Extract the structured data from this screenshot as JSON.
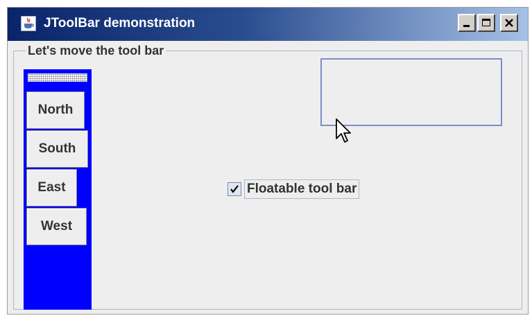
{
  "window": {
    "title": "JToolBar demonstration",
    "app_icon": "java-cup-icon",
    "controls": {
      "minimize_icon": "minimize-icon",
      "maximize_icon": "maximize-icon",
      "close_icon": "close-icon"
    },
    "titlebar_colors": [
      "#0a246a",
      "#a6c1e6"
    ]
  },
  "group": {
    "title": "Let's move the tool bar"
  },
  "toolbar": {
    "background": "#0000ff",
    "buttons": [
      {
        "label": "North"
      },
      {
        "label": "South"
      },
      {
        "label": "East"
      },
      {
        "label": "West"
      }
    ]
  },
  "floatable_checkbox": {
    "label": "Floatable tool bar",
    "checked": true
  },
  "cursor_icon": "arrow-pointer-icon"
}
